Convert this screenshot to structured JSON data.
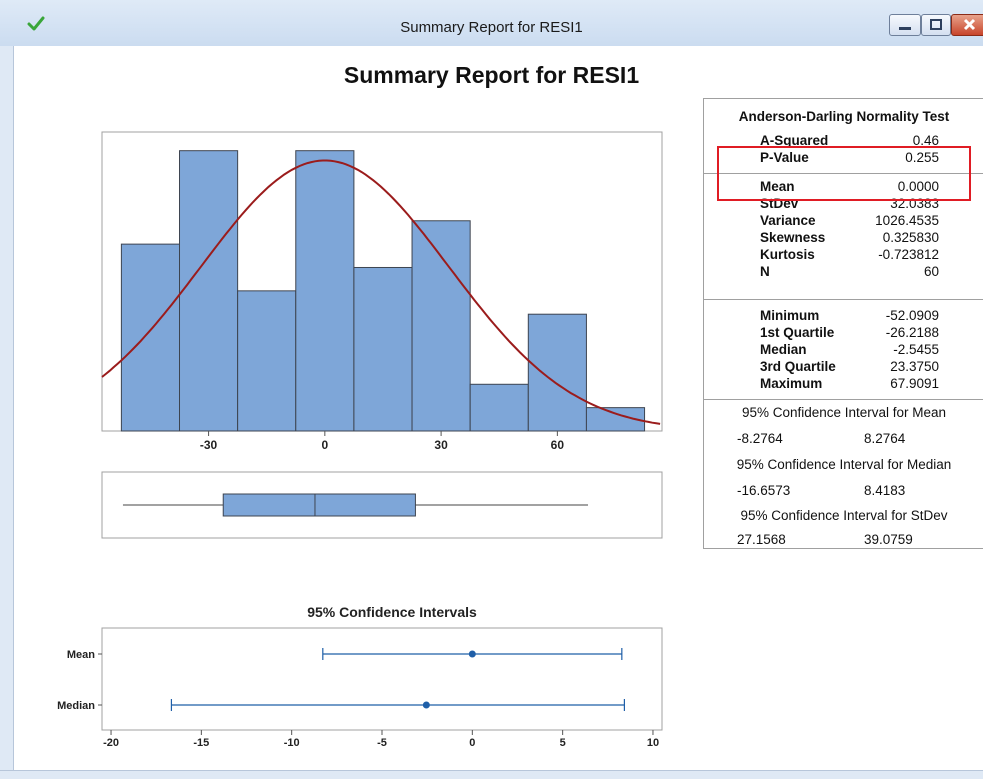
{
  "window": {
    "title": "Summary Report for RESI1",
    "controls": [
      "minimize",
      "maximize",
      "close"
    ]
  },
  "report": {
    "title": "Summary Report for RESI1"
  },
  "stats": {
    "ad_header": "Anderson-Darling Normality Test",
    "rows": [
      {
        "label": "A-Squared",
        "value": "0.46"
      },
      {
        "label": "P-Value",
        "value": "0.255"
      },
      {
        "label": "Mean",
        "value": "0.0000"
      },
      {
        "label": "StDev",
        "value": "32.0383"
      },
      {
        "label": "Variance",
        "value": "1026.4535"
      },
      {
        "label": "Skewness",
        "value": "0.325830"
      },
      {
        "label": "Kurtosis",
        "value": "-0.723812"
      },
      {
        "label": "N",
        "value": "60"
      }
    ],
    "quartiles": [
      {
        "label": "Minimum",
        "value": "-52.0909"
      },
      {
        "label": "1st Quartile",
        "value": "-26.2188"
      },
      {
        "label": "Median",
        "value": "-2.5455"
      },
      {
        "label": "3rd Quartile",
        "value": "23.3750"
      },
      {
        "label": "Maximum",
        "value": "67.9091"
      }
    ],
    "ci": [
      {
        "header": "95% Confidence Interval for Mean",
        "low": "-8.2764",
        "high": "8.2764"
      },
      {
        "header": "95% Confidence Interval for Median",
        "low": "-16.6573",
        "high": "8.4183"
      },
      {
        "header": "95% Confidence Interval for StDev",
        "low": "27.1568",
        "high": "39.0759"
      }
    ],
    "highlight_color": "#e01c24"
  },
  "chart_data": [
    {
      "type": "bar",
      "chart": "histogram",
      "bin_edges": [
        -52.5,
        -37.5,
        -22.5,
        -7.5,
        7.5,
        22.5,
        37.5,
        52.5,
        67.5,
        82.5
      ],
      "values": [
        8,
        12,
        6,
        12,
        7,
        9,
        2,
        5,
        1
      ],
      "x_ticks": [
        -30,
        0,
        30,
        60
      ],
      "xlim": [
        -57.5,
        87
      ],
      "ylim": [
        0,
        12.8
      ],
      "bar_color": "#7ea6d8",
      "curve": {
        "distribution": "normal",
        "mean": 0.0,
        "stdev": 32.0383,
        "color": "#9b1c1c"
      }
    },
    {
      "type": "boxplot",
      "min": -52.0909,
      "q1": -26.2188,
      "median": -2.5455,
      "q3": 23.375,
      "max": 67.9091,
      "xlim": [
        -57.5,
        87
      ],
      "box_color": "#7ea6d8"
    },
    {
      "type": "interval",
      "title": "95% Confidence Intervals",
      "categories": [
        "Mean",
        "Median"
      ],
      "intervals": [
        {
          "name": "Mean",
          "low": -8.2764,
          "center": 0.0,
          "high": 8.2764
        },
        {
          "name": "Median",
          "low": -16.6573,
          "center": -2.5455,
          "high": 8.4183
        }
      ],
      "x_ticks": [
        -20,
        -15,
        -10,
        -5,
        0,
        5,
        10
      ],
      "xlim": [
        -20.5,
        10.5
      ],
      "color": "#1f5fa8"
    }
  ]
}
